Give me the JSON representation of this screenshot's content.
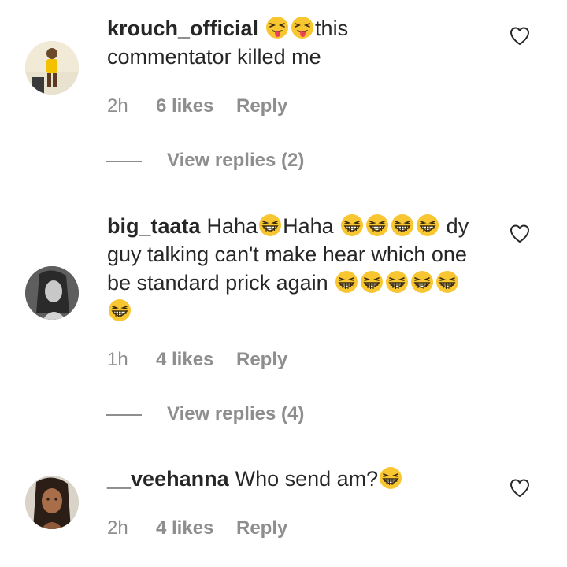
{
  "comments": [
    {
      "username": "krouch_official",
      "emojis_before": [
        "tongue-face-emoji",
        "tongue-face-emoji"
      ],
      "text_parts": [
        "this",
        "commentator killed me"
      ],
      "time": "2h",
      "likes": "6 likes",
      "reply": "Reply",
      "view_replies": "View replies (2)"
    },
    {
      "username": "big_taata",
      "text_1": "Haha",
      "text_2": "Haha",
      "text_3": "dy",
      "text_4": "guy talking can't make hear which one",
      "text_5": "be standard prick again",
      "time": "1h",
      "likes": "4 likes",
      "reply": "Reply",
      "view_replies": "View replies (4)"
    },
    {
      "username": "__veehanna",
      "text_1": "Who send am?",
      "time": "2h",
      "likes": "4 likes",
      "reply": "Reply"
    }
  ],
  "colors": {
    "text": "#262626",
    "muted": "#8e8e8e",
    "emoji_yellow": "#f7c631"
  },
  "icons": {
    "like": "heart-outline-icon",
    "laugh": "grinning-squinting-face-emoji",
    "tongue": "squinting-face-with-tongue-emoji"
  }
}
